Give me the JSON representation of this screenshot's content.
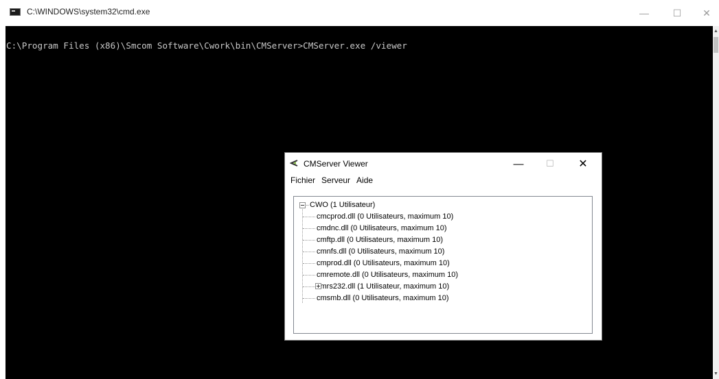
{
  "cmd_window": {
    "title": "C:\\WINDOWS\\system32\\cmd.exe",
    "icon": "console-icon",
    "controls": {
      "minimize": "—",
      "maximize": "☐",
      "close": "✕"
    },
    "console_line": "C:\\Program Files (x86)\\Smcom Software\\Cwork\\bin\\CMServer>CMServer.exe /viewer",
    "colors": {
      "background": "#000000",
      "text": "#c8c8c8"
    }
  },
  "viewer_window": {
    "title": "CMServer Viewer",
    "icon": "cmserver-app-icon",
    "controls": {
      "minimize": "—",
      "maximize": "☐",
      "close": "✕"
    },
    "menu": [
      "Fichier",
      "Serveur",
      "Aide"
    ],
    "tree": {
      "root": {
        "label": "CWO (1 Utilisateur)",
        "expanded": true
      },
      "items": [
        {
          "label": "cmcprod.dll (0 Utilisateurs, maximum 10)",
          "expandable": false
        },
        {
          "label": "cmdnc.dll (0 Utilisateurs, maximum 10)",
          "expandable": false
        },
        {
          "label": "cmftp.dll (0 Utilisateurs, maximum 10)",
          "expandable": false
        },
        {
          "label": "cmnfs.dll (0 Utilisateurs, maximum 10)",
          "expandable": false
        },
        {
          "label": "cmprod.dll (0 Utilisateurs, maximum 10)",
          "expandable": false
        },
        {
          "label": "cmremote.dll (0 Utilisateurs, maximum 10)",
          "expandable": false
        },
        {
          "label": "cmrs232.dll (1 Utilisateur, maximum 10)",
          "expandable": true
        },
        {
          "label": "cmsmb.dll (0 Utilisateurs, maximum 10)",
          "expandable": false
        }
      ]
    }
  }
}
